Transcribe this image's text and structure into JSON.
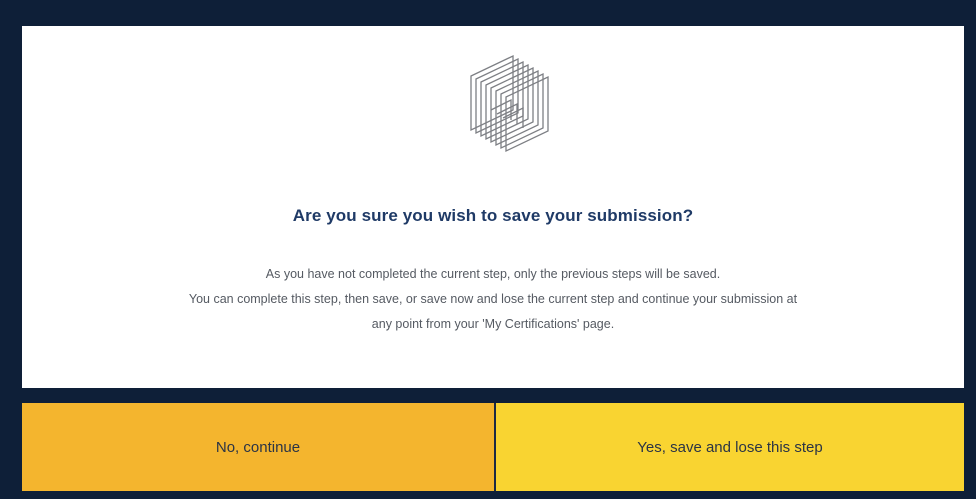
{
  "dialog": {
    "title": "Are you sure you wish to save your submission?",
    "message_lines": [
      "As you have not completed the current step, only the previous steps will be saved.",
      "You can complete this step, then save, or save now and lose the current step and continue your submission at",
      "any point from your 'My Certifications' page."
    ],
    "logo_icon": "layered-cube-logo-icon"
  },
  "buttons": {
    "no_label": "No, continue",
    "yes_label": "Yes, save and lose this step"
  },
  "colors": {
    "backdrop": "#0e1f38",
    "title": "#1f3a66",
    "no_button": "#f4b52e",
    "yes_button": "#f9d431"
  }
}
